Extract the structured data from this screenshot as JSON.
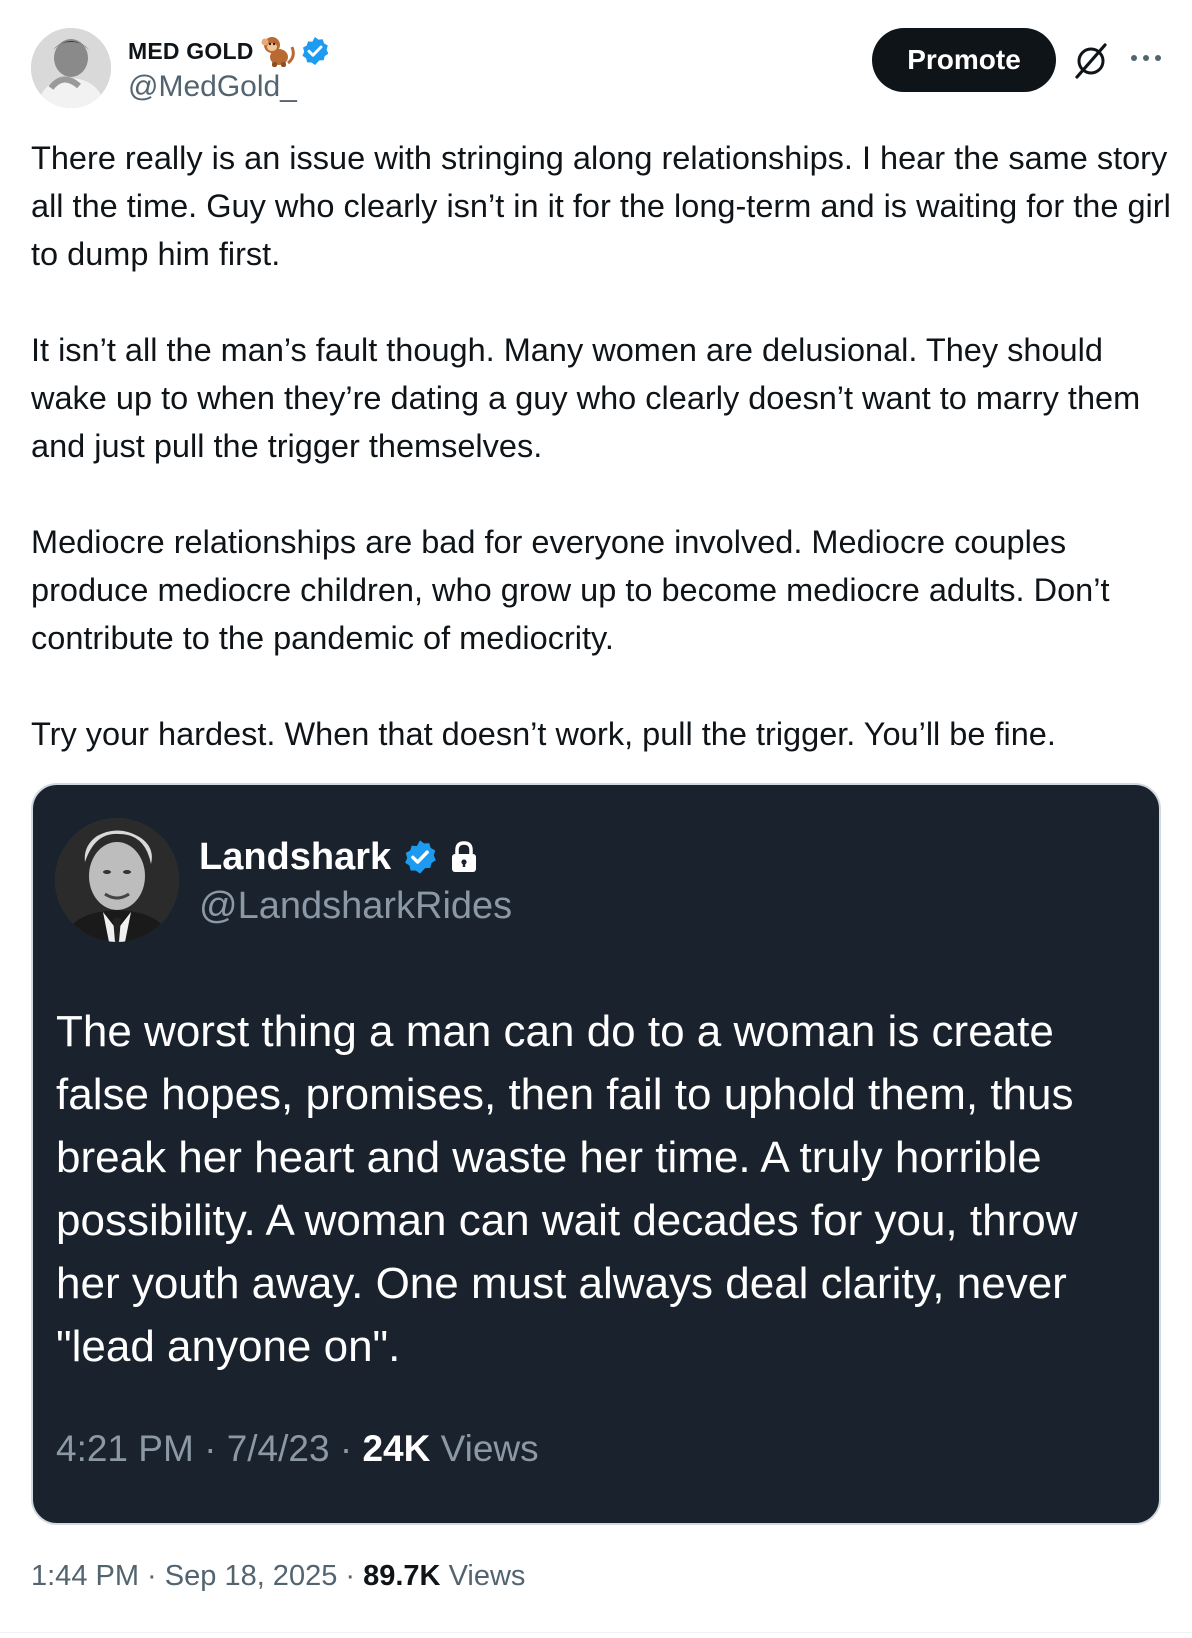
{
  "author": {
    "display_name": "MED GOLD",
    "handle": "@MedGold_",
    "badge_emoji": "monkey",
    "verified": true
  },
  "actions": {
    "promote_label": "Promote",
    "grok_icon": "slashed-circle-icon",
    "more_icon": "more-icon"
  },
  "post": {
    "paragraphs": [
      "There really is an issue with stringing along relationships. I hear the same story all the time. Guy who clearly isn’t in it for the long-term and is waiting for the girl to dump him first.",
      "It isn’t all the man’s fault though. Many women are delusional. They should wake up to when they’re dating a guy who clearly doesn’t want to marry them and just pull the trigger themselves.",
      "Mediocre relationships are bad for everyone involved. Mediocre couples produce mediocre children, who grow up to become mediocre adults. Don’t contribute to the pandemic of mediocrity.",
      "Try your hardest. When that doesn’t work, pull the trigger. You’ll be fine."
    ],
    "time": "1:44 PM",
    "date": "Sep 18, 2025",
    "views_count": "89.7K",
    "views_label": "Views"
  },
  "quote": {
    "display_name": "Landshark",
    "handle": "@LandsharkRides",
    "verified": true,
    "protected": true,
    "text": "The worst thing a man can do to a woman is create false hopes, promises, then fail to uphold them, thus break her heart and waste her time. A truly horrible possibility. A woman can wait decades for you, throw her youth away. One must always deal clarity, never \"lead anyone on\".",
    "time": "4:21 PM",
    "date": "7/4/23",
    "views_count": "24K",
    "views_label": "Views"
  },
  "colors": {
    "text_primary": "#0f1419",
    "text_secondary": "#536471",
    "verified_blue": "#1d9bf0",
    "quote_bg": "#1a222d",
    "quote_muted": "#8b98a5"
  }
}
